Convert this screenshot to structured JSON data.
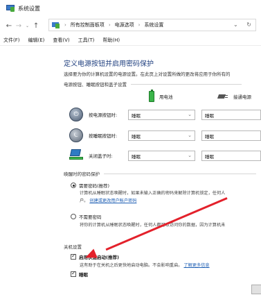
{
  "window": {
    "title": "系统设置"
  },
  "nav": {
    "back": "←",
    "forward": "→",
    "dropdown": "⌄",
    "up": "↑",
    "breadcrumbs": [
      "所有控制面板项",
      "电源选项",
      "系统设置"
    ],
    "refresh_label": "↻",
    "addr_dropdown": "⌄"
  },
  "menu": [
    "文件(F)",
    "编辑(E)",
    "查看(V)",
    "工具(T)",
    "帮助(H)"
  ],
  "page": {
    "heading": "定义电源按钮并启用密码保护",
    "description": "选择要为你的计算机设置的电源设置。在此页上对设置所做的更改将应用于你所有的"
  },
  "power_section": {
    "label": "电源按钮、睡眠按钮和盖子设置",
    "battery_label": "用电池",
    "plugged_label": "接通电源",
    "rows": [
      {
        "label": "按电源按钮时:",
        "battery": "睡眠",
        "plugged": "睡眠",
        "icon": "power-icon"
      },
      {
        "label": "按睡眠按钮时:",
        "battery": "睡眠",
        "plugged": "睡眠",
        "icon": "sleep-icon"
      },
      {
        "label": "关闭盖子时:",
        "battery": "睡眠",
        "plugged": "睡眠",
        "icon": "laptop-lid-icon"
      }
    ]
  },
  "password_section": {
    "label": "唤醒时的密码保护",
    "require": {
      "label": "需要密码(推荐)",
      "desc": "计算机从睡眠状态唤醒时，如果未输入正确的密码来解除计算机锁定，任何人",
      "link": "创建或更改用户帐户密码",
      "link_prefix": "户。"
    },
    "no_require": {
      "label": "不需要密码",
      "desc": "将你的计算机从睡眠状态唤醒时，任何人都可以访问你的数据，因为计算机未"
    }
  },
  "shutdown_section": {
    "label": "关机设置",
    "fast_startup": {
      "label": "启用快速启动(推荐)",
      "desc": "这有助于在关机之后更快地启动电脑。不会影响重启。",
      "link": "了解更多信息"
    },
    "sleep_label": "睡眠"
  },
  "colors": {
    "accent_heading": "#1f3f7f",
    "link": "#1e5fb4",
    "annotation_arrow": "#e3212b"
  }
}
